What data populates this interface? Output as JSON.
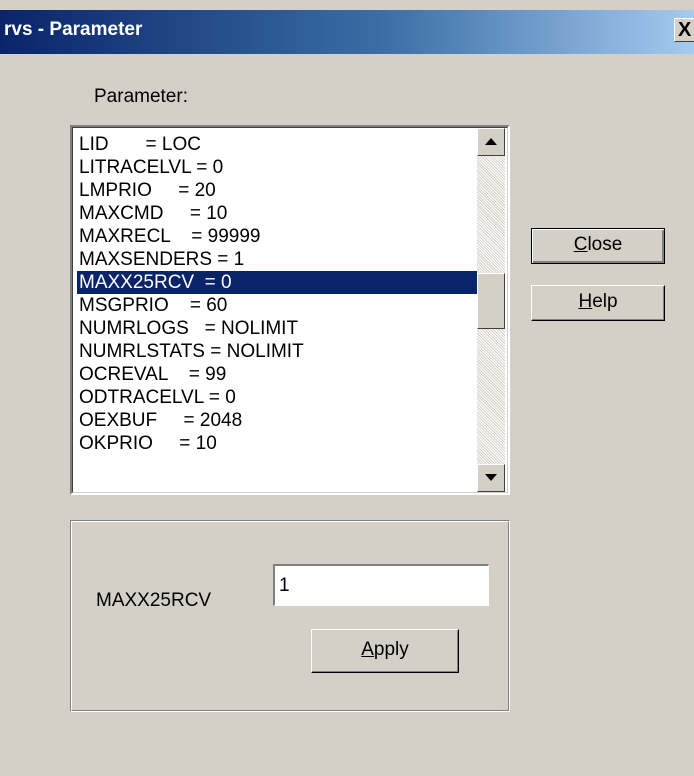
{
  "window": {
    "title": "rvs - Parameter",
    "close_glyph": "X"
  },
  "parameter_label": "Parameter:",
  "list": {
    "items": [
      "LID       = LOC",
      "LITRACELVL = 0",
      "LMPRIO     = 20",
      "MAXCMD     = 10",
      "MAXRECL    = 99999",
      "MAXSENDERS = 1",
      "MAXX25RCV  = 0",
      "MSGPRIO    = 60",
      "NUMRLOGS   = NOLIMIT",
      "NUMRLSTATS = NOLIMIT",
      "OCREVAL    = 99",
      "ODTRACELVL = 0",
      "OEXBUF     = 2048",
      "OKPRIO     = 10"
    ],
    "selected_index": 6
  },
  "buttons": {
    "close_prefix": "C",
    "close_rest": "lose",
    "help_prefix": "H",
    "help_rest": "elp",
    "apply_prefix": "A",
    "apply_rest": "pply"
  },
  "edit": {
    "label": "MAXX25RCV",
    "value": "1"
  },
  "colors": {
    "selection": "#0a246a",
    "face": "#d4d0c8"
  }
}
